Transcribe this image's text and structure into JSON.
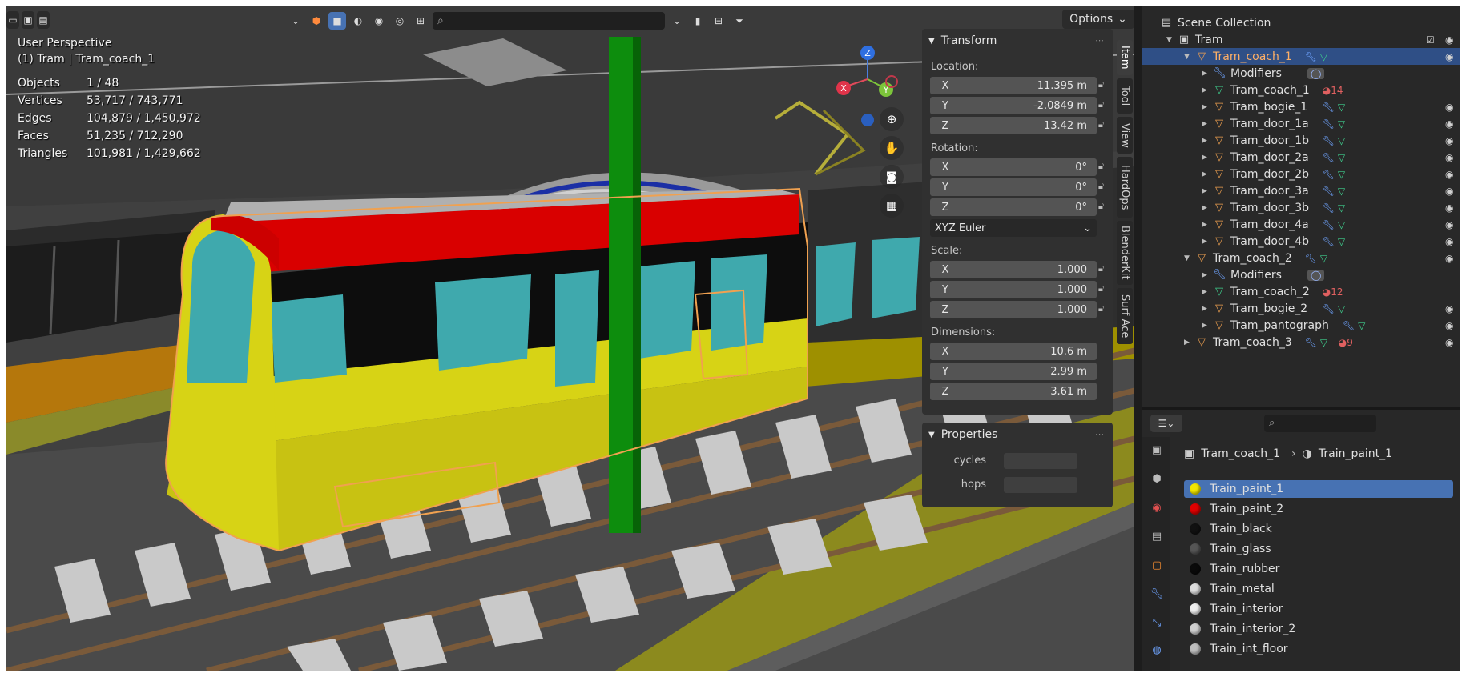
{
  "viewport": {
    "perspective_label": "User Perspective",
    "context_label": "(1) Tram | Tram_coach_1",
    "stats": [
      {
        "label": "Objects",
        "value": "1 / 48"
      },
      {
        "label": "Vertices",
        "value": "53,717 / 743,771"
      },
      {
        "label": "Edges",
        "value": "104,879 / 1,450,972"
      },
      {
        "label": "Faces",
        "value": "51,235 / 712,290"
      },
      {
        "label": "Triangles",
        "value": "101,981 / 1,429,662"
      }
    ],
    "options_label": "Options",
    "gizmo": {
      "x": "X",
      "y": "Y",
      "z": "Z"
    }
  },
  "npanel": {
    "tabs": [
      "Item",
      "Tool",
      "View",
      "HardOps",
      "BlenderKit",
      "Surf Ace"
    ],
    "active_tab": "Item",
    "transform": {
      "title": "Transform",
      "location_label": "Location:",
      "location": [
        {
          "axis": "X",
          "value": "11.395 m"
        },
        {
          "axis": "Y",
          "value": "-2.0849 m"
        },
        {
          "axis": "Z",
          "value": "13.42 m"
        }
      ],
      "rotation_label": "Rotation:",
      "rotation": [
        {
          "axis": "X",
          "value": "0°"
        },
        {
          "axis": "Y",
          "value": "0°"
        },
        {
          "axis": "Z",
          "value": "0°"
        }
      ],
      "rotation_mode": "XYZ Euler",
      "scale_label": "Scale:",
      "scale": [
        {
          "axis": "X",
          "value": "1.000"
        },
        {
          "axis": "Y",
          "value": "1.000"
        },
        {
          "axis": "Z",
          "value": "1.000"
        }
      ],
      "dimensions_label": "Dimensions:",
      "dimensions": [
        {
          "axis": "X",
          "value": "10.6 m"
        },
        {
          "axis": "Y",
          "value": "2.99 m"
        },
        {
          "axis": "Z",
          "value": "3.61 m"
        }
      ]
    },
    "properties": {
      "title": "Properties",
      "fields": [
        {
          "label": "cycles"
        },
        {
          "label": "hops"
        }
      ]
    }
  },
  "outliner": {
    "rows": [
      {
        "name": "Scene Collection",
        "type": "scene",
        "depth": 0
      },
      {
        "name": "Tram",
        "type": "collection",
        "depth": 1,
        "expanded": true
      },
      {
        "name": "Tram_coach_1",
        "type": "object",
        "depth": 2,
        "expanded": true,
        "selected": true
      },
      {
        "name": "Modifiers",
        "type": "modifiers",
        "depth": 3
      },
      {
        "name": "Tram_coach_1",
        "type": "mesh",
        "depth": 3,
        "badge": "14"
      },
      {
        "name": "Tram_bogie_1",
        "type": "object",
        "depth": 3
      },
      {
        "name": "Tram_door_1a",
        "type": "object",
        "depth": 3
      },
      {
        "name": "Tram_door_1b",
        "type": "object",
        "depth": 3
      },
      {
        "name": "Tram_door_2a",
        "type": "object",
        "depth": 3
      },
      {
        "name": "Tram_door_2b",
        "type": "object",
        "depth": 3
      },
      {
        "name": "Tram_door_3a",
        "type": "object",
        "depth": 3
      },
      {
        "name": "Tram_door_3b",
        "type": "object",
        "depth": 3
      },
      {
        "name": "Tram_door_4a",
        "type": "object",
        "depth": 3
      },
      {
        "name": "Tram_door_4b",
        "type": "object",
        "depth": 3
      },
      {
        "name": "Tram_coach_2",
        "type": "object",
        "depth": 2,
        "expanded": true
      },
      {
        "name": "Modifiers",
        "type": "modifiers",
        "depth": 3
      },
      {
        "name": "Tram_coach_2",
        "type": "mesh",
        "depth": 3,
        "badge": "12"
      },
      {
        "name": "Tram_bogie_2",
        "type": "object",
        "depth": 3
      },
      {
        "name": "Tram_pantograph",
        "type": "object",
        "depth": 3
      },
      {
        "name": "Tram_coach_3",
        "type": "object",
        "depth": 2,
        "badge": "9"
      }
    ]
  },
  "properties_editor": {
    "breadcrumb_object": "Tram_coach_1",
    "breadcrumb_material": "Train_paint_1",
    "materials": [
      {
        "name": "Train_paint_1",
        "color": "#f2e600",
        "selected": true
      },
      {
        "name": "Train_paint_2",
        "color": "#e00000"
      },
      {
        "name": "Train_black",
        "color": "#111111"
      },
      {
        "name": "Train_glass",
        "color": "#555555"
      },
      {
        "name": "Train_rubber",
        "color": "#0a0a0a"
      },
      {
        "name": "Train_metal",
        "color": "#dddddd"
      },
      {
        "name": "Train_interior",
        "color": "#eeeeee"
      },
      {
        "name": "Train_interior_2",
        "color": "#cfcfcf"
      },
      {
        "name": "Train_int_floor",
        "color": "#bdbdbd"
      }
    ]
  },
  "colors": {
    "selection": "#2f4f86",
    "active_blue": "#4772b3",
    "object_orange": "#f0a150",
    "mesh_green": "#3fcf8e",
    "modifier_blue": "#6fa4ff"
  }
}
